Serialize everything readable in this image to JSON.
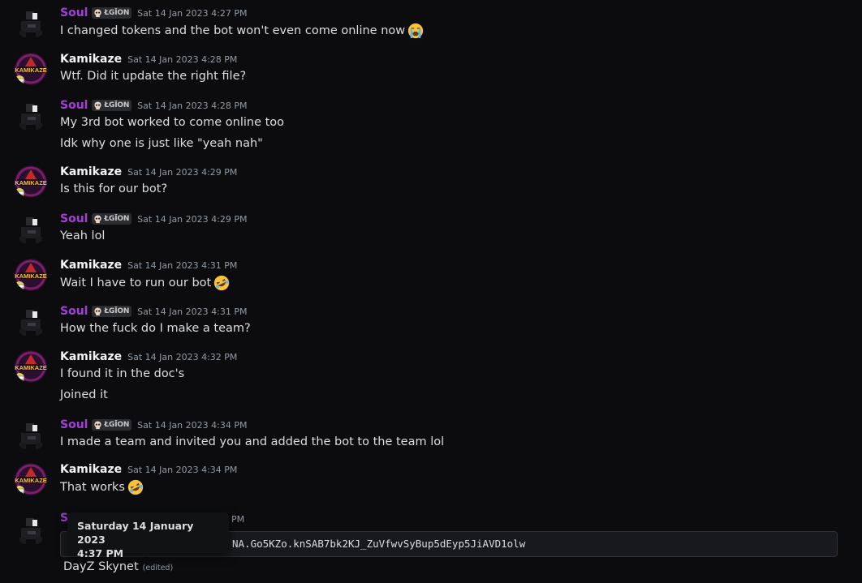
{
  "users": {
    "soul": {
      "name": "Soul",
      "tag": "ŁGĪON"
    },
    "kamikaze": {
      "name": "Kamikaze",
      "avatar_text": "KAMIKAZE"
    }
  },
  "messages": [
    {
      "user": "soul",
      "timestamp": "Sat 14 Jan 2023 4:27 PM",
      "lines": [
        "I changed tokens and the bot won't even come online now"
      ],
      "emoji": "loudly-crying-face-emoji"
    },
    {
      "user": "kamikaze",
      "timestamp": "Sat 14 Jan 2023 4:28 PM",
      "lines": [
        "Wtf. Did it update the right file?"
      ]
    },
    {
      "user": "soul",
      "timestamp": "Sat 14 Jan 2023 4:28 PM",
      "lines": [
        "My 3rd bot worked to come online too",
        "Idk why one is just like \"yeah nah\""
      ]
    },
    {
      "user": "kamikaze",
      "timestamp": "Sat 14 Jan 2023  4:29 PM",
      "lines": [
        "Is this for our bot?"
      ]
    },
    {
      "user": "soul",
      "timestamp": "Sat 14 Jan 2023 4:29 PM",
      "lines": [
        "Yeah lol"
      ]
    },
    {
      "user": "kamikaze",
      "timestamp": "Sat 14 Jan 2023 4:31 PM",
      "lines": [
        "Wait I have to run our bot"
      ],
      "emoji": "rofl-emoji"
    },
    {
      "user": "soul",
      "timestamp": "Sat 14 Jan 2023 4:31 PM",
      "lines": [
        "How the fuck do I make a team?"
      ]
    },
    {
      "user": "kamikaze",
      "timestamp": "Sat 14 Jan 2023 4:32 PM",
      "lines": [
        "I found it in the doc's",
        "Joined it"
      ]
    },
    {
      "user": "soul",
      "timestamp": "Sat 14 Jan 2023 4:34 PM",
      "lines": [
        "I made a team and invited you and added the bot to the team lol"
      ]
    },
    {
      "user": "kamikaze",
      "timestamp": "Sat 14 Jan 2023 4:34 PM",
      "lines": [
        "That works"
      ],
      "emoji": "rofl-emoji"
    }
  ],
  "last_message": {
    "user_partial": "S",
    "timestamp_partial": "PM",
    "code": "NA.Go5KZo.knSAB7bk2KJ_ZuVfwvSyBup5dEyp5JiAVD1olw",
    "text": "DayZ Skynet",
    "edited": "(edited)"
  },
  "tooltip": {
    "line1": "Saturday 14 January 2023",
    "line2": "4:37 PM"
  },
  "colors": {
    "background": "#0c0c0f",
    "soul_name": "#a23fd6",
    "kamikaze_name": "#f2f3f5",
    "timestamp": "#949ba4"
  }
}
